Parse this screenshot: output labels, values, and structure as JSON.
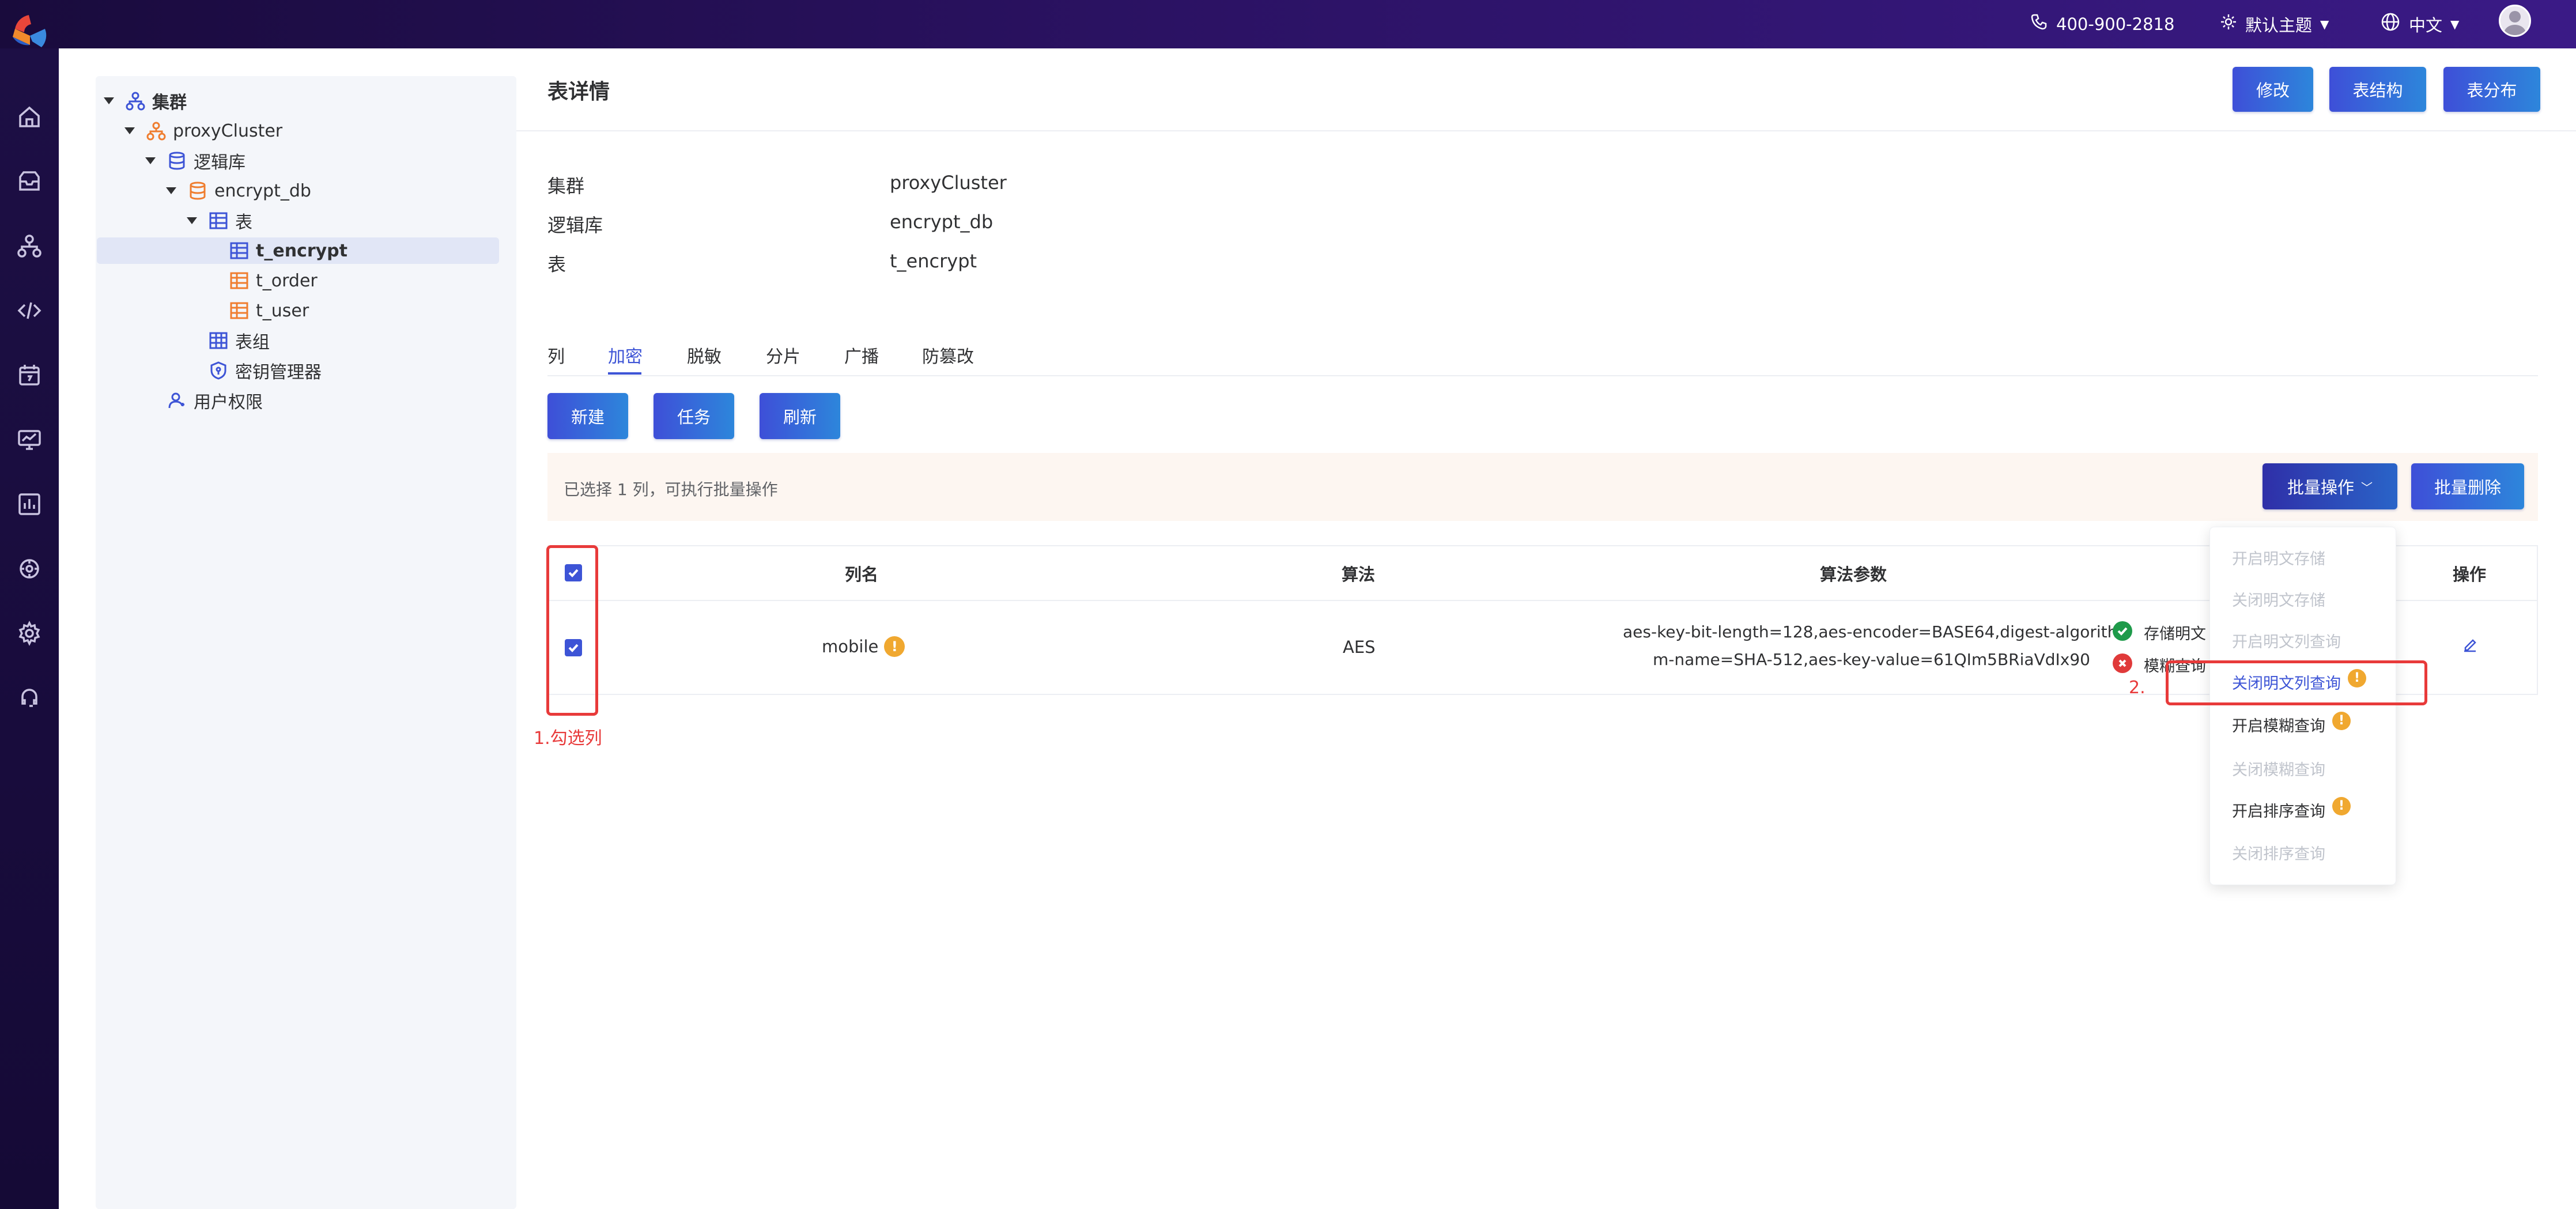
{
  "colors": {
    "accent": "#3d54d6",
    "button_gradient_start": "#3e4fd8",
    "button_gradient_end": "#2d86db",
    "topbar": "#2b1263",
    "annotation": "#e83a3a",
    "warning": "#f0a830",
    "success": "#1e9a4a",
    "danger": "#e03a3a"
  },
  "topbar": {
    "phone_icon": "phone-icon",
    "phone": "400-900-2818",
    "theme_icon": "sun-icon",
    "theme": "默认主题",
    "language_icon": "globe-icon",
    "language": "中文"
  },
  "rail_icons": [
    "home-icon",
    "database-icon",
    "cluster-icon",
    "code-icon",
    "calendar-icon",
    "monitor-icon",
    "chart-icon",
    "plugin-icon",
    "settings-icon",
    "headset-icon"
  ],
  "tree": {
    "cluster_group": "集群",
    "cluster": "proxyCluster",
    "logic_db_group": "逻辑库",
    "database": "encrypt_db",
    "table_group": "表",
    "tables": [
      "t_encrypt",
      "t_order",
      "t_user"
    ],
    "table_groups": "表组",
    "key_manager": "密钥管理器",
    "user_permissions": "用户权限"
  },
  "header": {
    "title": "表详情",
    "edit_button": "修改",
    "structure_button": "表结构",
    "distribution_button": "表分布"
  },
  "details": [
    {
      "label": "集群",
      "value": "proxyCluster"
    },
    {
      "label": "逻辑库",
      "value": "encrypt_db"
    },
    {
      "label": "表",
      "value": "t_encrypt"
    }
  ],
  "tabs": [
    "列",
    "加密",
    "脱敏",
    "分片",
    "广播",
    "防篡改"
  ],
  "active_tab": "加密",
  "actions": {
    "new": "新建",
    "task": "任务",
    "refresh": "刷新"
  },
  "batch": {
    "selection_text": "已选择 1 列，可执行批量操作",
    "batch_ops": "批量操作",
    "batch_delete": "批量删除"
  },
  "table": {
    "headers": {
      "column": "列名",
      "algorithm": "算法",
      "params": "算法参数",
      "ops": "操作"
    },
    "rows": [
      {
        "checked": true,
        "column": "mobile",
        "algorithm": "AES",
        "params_line1": "aes-key-bit-length=128,aes-encoder=BASE64,digest-algorith",
        "params_line2": "m-name=SHA-512,aes-key-value=61QIm5BRiaVdIx90",
        "status_plain": "存储明文",
        "status_fuzzy": "模糊查询"
      }
    ]
  },
  "dropdown": {
    "items": [
      {
        "label": "开启明文存储",
        "state": "disabled",
        "warn": false
      },
      {
        "label": "关闭明文存储",
        "state": "disabled",
        "warn": false
      },
      {
        "label": "开启明文列查询",
        "state": "disabled",
        "warn": false
      },
      {
        "label": "关闭明文列查询",
        "state": "highlight",
        "warn": true
      },
      {
        "label": "开启模糊查询",
        "state": "enabled",
        "warn": true
      },
      {
        "label": "关闭模糊查询",
        "state": "disabled",
        "warn": false
      },
      {
        "label": "开启排序查询",
        "state": "enabled",
        "warn": true
      },
      {
        "label": "关闭排序查询",
        "state": "disabled",
        "warn": false
      }
    ]
  },
  "annotations": {
    "step1": "1.勾选列",
    "step2": "2."
  }
}
